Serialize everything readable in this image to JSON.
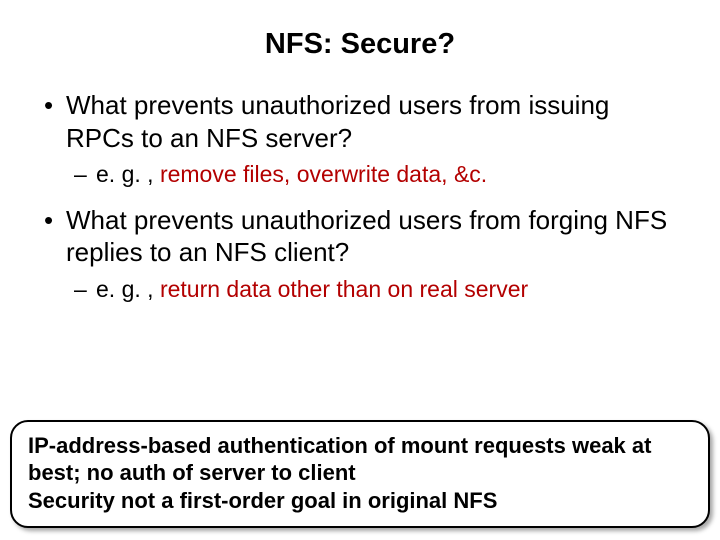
{
  "title": "NFS: Secure?",
  "bullets": [
    {
      "text": "What prevents unauthorized users from issuing RPCs to an NFS server?",
      "sub": {
        "prefix": "e. g. , ",
        "red": "remove files, overwrite data, &c."
      }
    },
    {
      "text": "What prevents unauthorized users from forging NFS replies to an NFS client?",
      "sub": {
        "prefix": "e. g. , ",
        "red": "return data other than on real server"
      }
    }
  ],
  "callout": {
    "line1": "IP-address-based authentication of mount requests weak at best; no auth of server to client",
    "line2": "Security not a first-order goal in original NFS"
  }
}
